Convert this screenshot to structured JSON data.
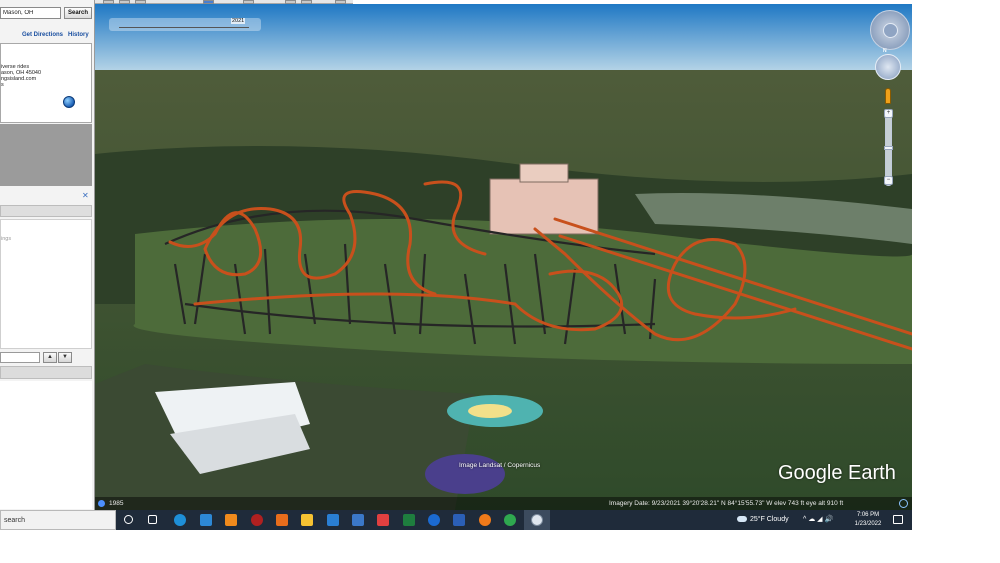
{
  "sidebar": {
    "search": {
      "value": "Mason, OH",
      "button_label": "Search"
    },
    "links": {
      "directions": "Get Directions",
      "history": "History"
    },
    "result_lines": [
      "iverse rides",
      "ason, OH 45040",
      "ngsisland.com",
      "s"
    ],
    "places_text": "ings"
  },
  "earth": {
    "timeslider_label": "2021",
    "credit": "Image Landsat / Copernicus",
    "watermark": "Google Earth",
    "status": {
      "year": "1985",
      "info": "Imagery Date: 9/23/2021    39°20'28.21\" N   84°15'55.73\" W   elev  743 ft      eye alt  910 ft"
    },
    "compass_letter": "N"
  },
  "taskbar": {
    "search_placeholder": "search",
    "weather": "25°F  Cloudy",
    "tray_glyphs": "^  ☁  ◢  🔊",
    "time": "7:06 PM",
    "date": "1/23/2022"
  },
  "colors": {
    "track_orange": "#c8501c",
    "taskbar_bg": "#1f2b3a"
  }
}
